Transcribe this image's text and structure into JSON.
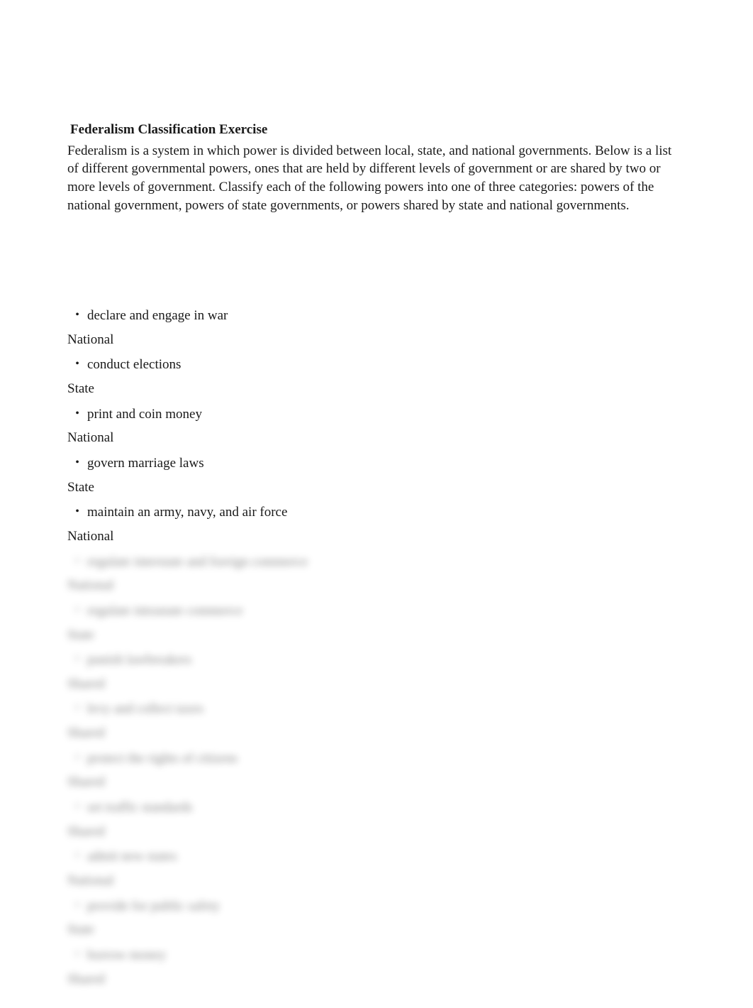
{
  "title": "Federalism Classification Exercise",
  "intro": "Federalism is a system in which power is divided between local, state, and national governments. Below is a list of different governmental powers, ones that are held by different levels of government or are shared by two or more levels of government. Classify each of the following powers into one of three categories: powers of the national government, powers of state governments, or powers shared by state and national governments.",
  "items": [
    {
      "power": "declare and engage in war",
      "answer": "National",
      "blurred": false
    },
    {
      "power": "conduct elections",
      "answer": "State",
      "blurred": false
    },
    {
      "power": "print and coin money",
      "answer": "National",
      "blurred": false
    },
    {
      "power": "govern marriage laws",
      "answer": "State",
      "blurred": false
    },
    {
      "power": "maintain an army, navy, and air force",
      "answer": "National",
      "blurred": false
    },
    {
      "power": "regulate interstate and foreign commerce",
      "answer": "National",
      "blurred": true
    },
    {
      "power": "regulate intrastate commerce",
      "answer": "State",
      "blurred": true
    },
    {
      "power": "punish lawbreakers",
      "answer": "Shared",
      "blurred": true
    },
    {
      "power": "levy and collect taxes",
      "answer": "Shared",
      "blurred": true
    },
    {
      "power": "protect the rights of citizens",
      "answer": "Shared",
      "blurred": true
    },
    {
      "power": "set traffic standards",
      "answer": "Shared",
      "blurred": true
    },
    {
      "power": "admit new states",
      "answer": "National",
      "blurred": true
    },
    {
      "power": "provide for public safety",
      "answer": "State",
      "blurred": true
    },
    {
      "power": "borrow money",
      "answer": "Shared",
      "blurred": true
    }
  ]
}
